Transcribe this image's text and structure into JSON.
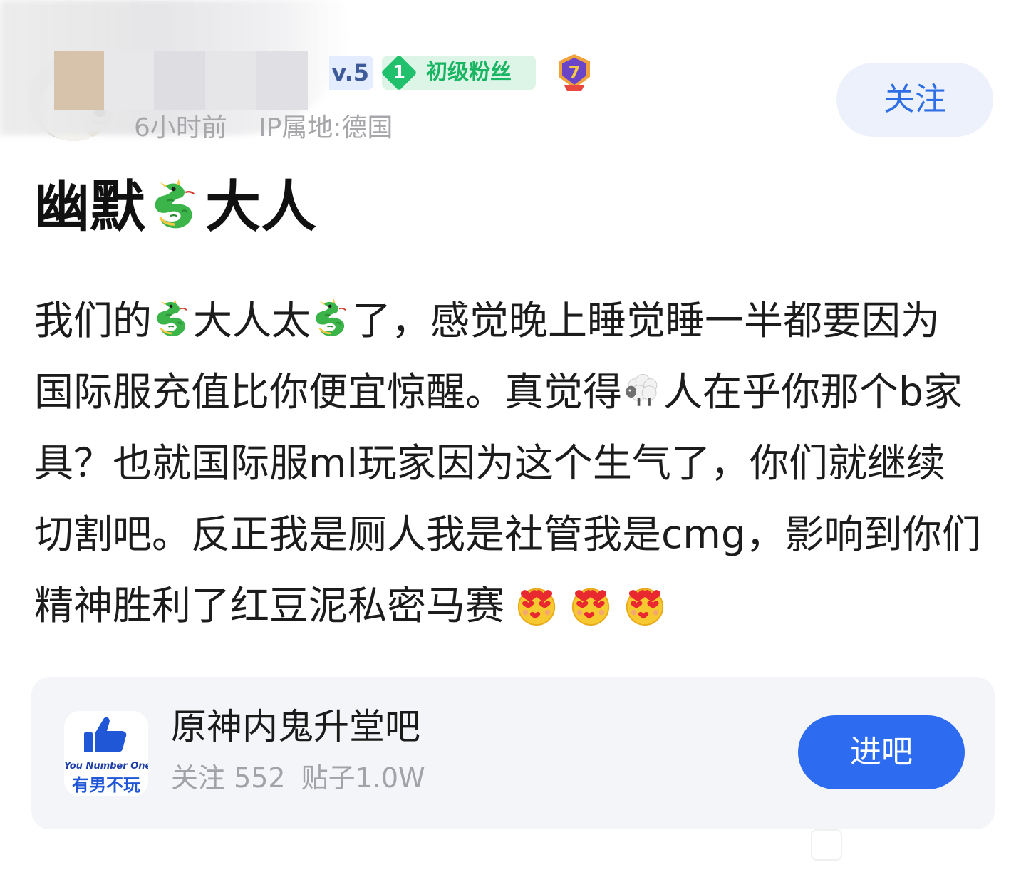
{
  "post": {
    "header": {
      "level_fragment": "v.5",
      "fan_badge_level": "1",
      "fan_badge_label": "初级粉丝",
      "medal_number": "7",
      "time": "6小时前",
      "ip": "IP属地:德国",
      "follow_label": "关注"
    },
    "title": {
      "part1": "幽默",
      "part2": "大人"
    },
    "body": {
      "l1a": "我们的",
      "l1b": "大人太",
      "l1c": "了，感觉晚上睡觉睡一半都要因为",
      "l2a": "国际服充值比你便宜惊醒。真觉得",
      "l2b": "人在乎你那个b家",
      "l3": "具？也就国际服ml玩家因为这个生气了，你们就继续",
      "l4": "切割吧。反正我是厕人我是社管我是cmg，影响到你们",
      "l5": "精神胜利了红豆泥私密马赛"
    }
  },
  "forum_card": {
    "logo_text_en": "You Number One",
    "logo_text_cn": "有男不玩",
    "name": "原神内鬼升堂吧",
    "followers": "关注 552",
    "posts": "贴子1.0W",
    "enter_label": "进吧"
  },
  "icons": {
    "dragon": "dragon-emoji-icon",
    "sheep": "sheep-emoji-icon",
    "heart_eyes": "heart-eyes-kiss-emoji-icon",
    "medal": "medal-icon"
  },
  "colors": {
    "follow_text": "#2f6fe6",
    "follow_bg": "#edf1fb",
    "enter_bg": "#2d6cf0",
    "fan_badge_green": "#19b563",
    "meta_gray": "#a7a7ab",
    "card_bg": "#f4f5f8"
  }
}
